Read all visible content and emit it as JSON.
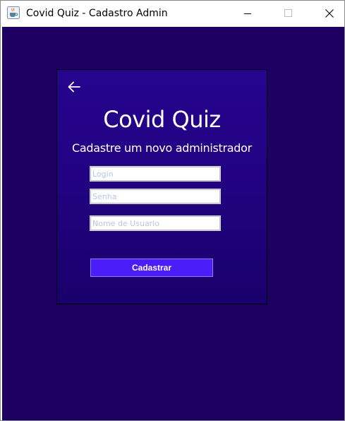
{
  "window": {
    "title": "Covid Quiz - Cadastro Admin"
  },
  "card": {
    "title": "Covid Quiz",
    "subtitle": "Cadastre um novo administrador"
  },
  "form": {
    "login_placeholder": "Login",
    "login_value": "",
    "senha_placeholder": "Senha",
    "senha_value": "",
    "nome_placeholder": "Nome de Usuario",
    "nome_value": "",
    "submit_label": "Cadastrar"
  },
  "icons": {
    "app": "java-cup-icon",
    "back": "arrow-left-icon",
    "minimize": "minimize-icon",
    "maximize": "maximize-icon",
    "close": "close-icon"
  },
  "colors": {
    "background": "#1d0062",
    "card": "#22038a",
    "button": "#4c1dfb",
    "placeholder": "#b6c6e4"
  }
}
